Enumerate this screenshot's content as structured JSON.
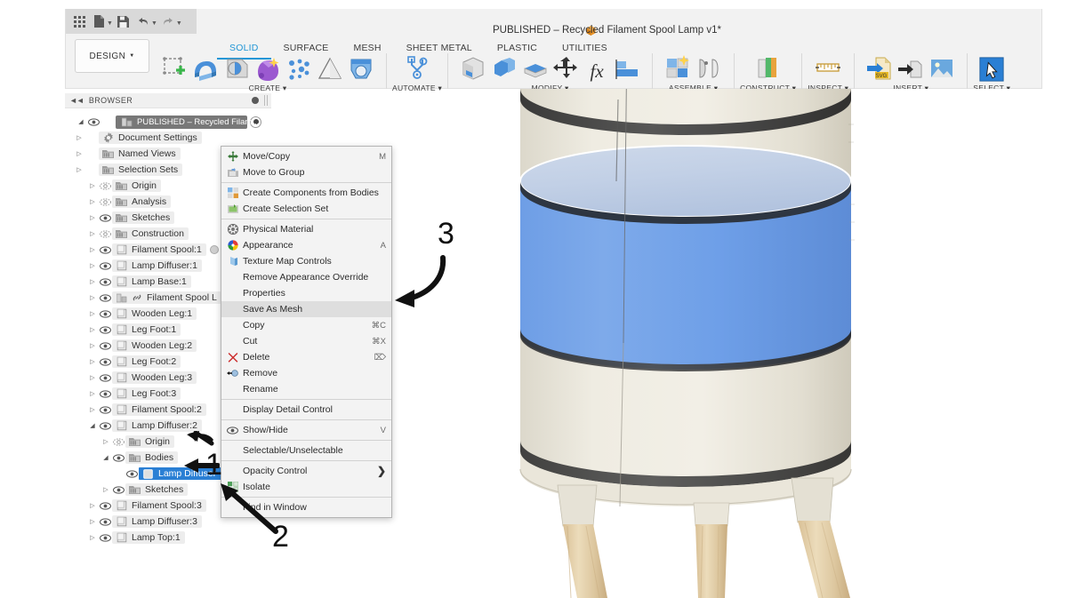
{
  "window": {
    "title": "PUBLISHED – Recycled Filament Spool Lamp v1*",
    "title_icon": "cube-icon"
  },
  "quickbar": {
    "items": [
      {
        "name": "app-grid-icon",
        "label": "grid"
      },
      {
        "name": "new-document-icon",
        "label": "file"
      },
      {
        "name": "save-icon",
        "label": "save"
      },
      {
        "name": "undo-icon",
        "label": "undo"
      },
      {
        "name": "redo-icon",
        "label": "redo"
      }
    ]
  },
  "workspace": {
    "selector_label": "DESIGN"
  },
  "tabs": [
    {
      "label": "SOLID",
      "active": true
    },
    {
      "label": "SURFACE",
      "active": false
    },
    {
      "label": "MESH",
      "active": false
    },
    {
      "label": "SHEET METAL",
      "active": false
    },
    {
      "label": "PLASTIC",
      "active": false
    },
    {
      "label": "UTILITIES",
      "active": false
    }
  ],
  "ribbon": {
    "groups": [
      {
        "label": "CREATE ▾",
        "name": "create-group",
        "icon_count": 7
      },
      {
        "label": "AUTOMATE ▾",
        "name": "automate-group",
        "icon_count": 1
      },
      {
        "label": "MODIFY ▾",
        "name": "modify-group",
        "icon_count": 6
      },
      {
        "label": "ASSEMBLE ▾",
        "name": "assemble-group",
        "icon_count": 2
      },
      {
        "label": "CONSTRUCT ▾",
        "name": "construct-group",
        "icon_count": 1
      },
      {
        "label": "INSPECT ▾",
        "name": "inspect-group",
        "icon_count": 1
      },
      {
        "label": "INSERT ▾",
        "name": "insert-group",
        "icon_count": 3
      },
      {
        "label": "SELECT ▾",
        "name": "select-group",
        "icon_count": 1
      }
    ]
  },
  "browser": {
    "header_label": "BROWSER",
    "root": {
      "label": "PUBLISHED – Recycled Filam...",
      "indent": 0
    },
    "items": [
      {
        "label": "Document Settings",
        "icon": "gear-icon",
        "indent": 1,
        "eye": "none",
        "arrow": "closed"
      },
      {
        "label": "Named Views",
        "icon": "folder-icon",
        "indent": 1,
        "eye": "none",
        "arrow": "closed"
      },
      {
        "label": "Selection Sets",
        "icon": "folder-icon",
        "indent": 1,
        "eye": "none",
        "arrow": "closed"
      },
      {
        "label": "Origin",
        "icon": "folder-icon",
        "indent": 2,
        "eye": "hidden",
        "arrow": "closed"
      },
      {
        "label": "Analysis",
        "icon": "folder-icon",
        "indent": 2,
        "eye": "hidden",
        "arrow": "closed"
      },
      {
        "label": "Sketches",
        "icon": "folder-icon",
        "indent": 2,
        "eye": "visible",
        "arrow": "closed"
      },
      {
        "label": "Construction",
        "icon": "folder-icon",
        "indent": 2,
        "eye": "hidden",
        "arrow": "closed"
      },
      {
        "label": "Filament Spool:1",
        "icon": "component-icon",
        "indent": 2,
        "eye": "visible",
        "arrow": "closed",
        "badge": "appearance-dot"
      },
      {
        "label": "Lamp Diffuser:1",
        "icon": "component-icon",
        "indent": 2,
        "eye": "visible",
        "arrow": "closed"
      },
      {
        "label": "Lamp Base:1",
        "icon": "component-icon",
        "indent": 2,
        "eye": "visible",
        "arrow": "closed"
      },
      {
        "label": "Filament Spool L",
        "icon": "assembly-icon",
        "indent": 2,
        "eye": "visible",
        "arrow": "closed",
        "link": true
      },
      {
        "label": "Wooden Leg:1",
        "icon": "component-icon",
        "indent": 2,
        "eye": "visible",
        "arrow": "closed"
      },
      {
        "label": "Leg Foot:1",
        "icon": "component-icon",
        "indent": 2,
        "eye": "visible",
        "arrow": "closed"
      },
      {
        "label": "Wooden Leg:2",
        "icon": "component-icon",
        "indent": 2,
        "eye": "visible",
        "arrow": "closed"
      },
      {
        "label": "Leg Foot:2",
        "icon": "component-icon",
        "indent": 2,
        "eye": "visible",
        "arrow": "closed"
      },
      {
        "label": "Wooden Leg:3",
        "icon": "component-icon",
        "indent": 2,
        "eye": "visible",
        "arrow": "closed"
      },
      {
        "label": "Leg Foot:3",
        "icon": "component-icon",
        "indent": 2,
        "eye": "visible",
        "arrow": "closed"
      },
      {
        "label": "Filament Spool:2",
        "icon": "component-icon",
        "indent": 2,
        "eye": "visible",
        "arrow": "closed"
      },
      {
        "label": "Lamp Diffuser:2",
        "icon": "component-icon",
        "indent": 2,
        "eye": "visible",
        "arrow": "open"
      },
      {
        "label": "Origin",
        "icon": "folder-icon",
        "indent": 3,
        "eye": "hidden",
        "arrow": "closed"
      },
      {
        "label": "Bodies",
        "icon": "folder-icon",
        "indent": 3,
        "eye": "visible",
        "arrow": "open"
      },
      {
        "label": "Lamp Diffuser",
        "icon": "body-icon",
        "indent": 4,
        "eye": "visible",
        "arrow": "none",
        "selected": true
      },
      {
        "label": "Sketches",
        "icon": "folder-icon",
        "indent": 3,
        "eye": "visible",
        "arrow": "closed"
      },
      {
        "label": "Filament Spool:3",
        "icon": "component-icon",
        "indent": 2,
        "eye": "visible",
        "arrow": "closed"
      },
      {
        "label": "Lamp Diffuser:3",
        "icon": "component-icon",
        "indent": 2,
        "eye": "visible",
        "arrow": "closed"
      },
      {
        "label": "Lamp Top:1",
        "icon": "component-icon",
        "indent": 2,
        "eye": "visible",
        "arrow": "closed"
      }
    ]
  },
  "context_menu": {
    "items": [
      {
        "label": "Move/Copy",
        "shortcut": "M",
        "icon": "move-icon",
        "sep_after": false
      },
      {
        "label": "Move to Group",
        "shortcut": "",
        "icon": "move-group-icon",
        "sep_after": true
      },
      {
        "label": "Create Components from Bodies",
        "shortcut": "",
        "icon": "create-comp-icon",
        "sep_after": false
      },
      {
        "label": "Create Selection Set",
        "shortcut": "",
        "icon": "selection-set-icon",
        "sep_after": true
      },
      {
        "label": "Physical Material",
        "shortcut": "",
        "icon": "material-icon",
        "sep_after": false
      },
      {
        "label": "Appearance",
        "shortcut": "A",
        "icon": "appearance-icon",
        "sep_after": false
      },
      {
        "label": "Texture Map Controls",
        "shortcut": "",
        "icon": "texture-map-icon",
        "sep_after": false
      },
      {
        "label": "Remove Appearance Override",
        "shortcut": "",
        "icon": "",
        "sep_after": false
      },
      {
        "label": "Properties",
        "shortcut": "",
        "icon": "",
        "sep_after": false
      },
      {
        "label": "Save As Mesh",
        "shortcut": "",
        "icon": "",
        "sep_after": false,
        "highlighted": true
      },
      {
        "label": "Copy",
        "shortcut": "⌘C",
        "icon": "",
        "sep_after": false
      },
      {
        "label": "Cut",
        "shortcut": "⌘X",
        "icon": "",
        "sep_after": false
      },
      {
        "label": "Delete",
        "shortcut": "⌦",
        "icon": "delete-icon",
        "sep_after": false
      },
      {
        "label": "Remove",
        "shortcut": "",
        "icon": "remove-icon",
        "sep_after": false
      },
      {
        "label": "Rename",
        "shortcut": "",
        "icon": "",
        "sep_after": true
      },
      {
        "label": "Display Detail Control",
        "shortcut": "",
        "icon": "",
        "sep_after": true
      },
      {
        "label": "Show/Hide",
        "shortcut": "V",
        "icon": "eye-icon",
        "sep_after": true
      },
      {
        "label": "Selectable/Unselectable",
        "shortcut": "",
        "icon": "",
        "sep_after": true
      },
      {
        "label": "Opacity Control",
        "shortcut": "",
        "icon": "",
        "sep_after": false,
        "submenu": true
      },
      {
        "label": "Isolate",
        "shortcut": "",
        "icon": "isolate-icon",
        "sep_after": true
      },
      {
        "label": "Find in Window",
        "shortcut": "",
        "icon": "",
        "sep_after": false
      }
    ]
  },
  "annotations": [
    {
      "number": "1",
      "name": "annotation-1",
      "target": "bodies-folder-row"
    },
    {
      "number": "2",
      "name": "annotation-2",
      "target": "lamp-diffuser-body-row"
    },
    {
      "number": "3",
      "name": "annotation-3",
      "target": "save-as-mesh-menu-item"
    }
  ],
  "viewport": {
    "model_name": "Recycled Filament Spool Lamp",
    "selected_body_color": "#6f9fe8",
    "spool_color": "#e8e4d8",
    "leg_color": "#e3cfa8",
    "rim_color": "#3a3a3a",
    "background_color": "#ffffff"
  }
}
